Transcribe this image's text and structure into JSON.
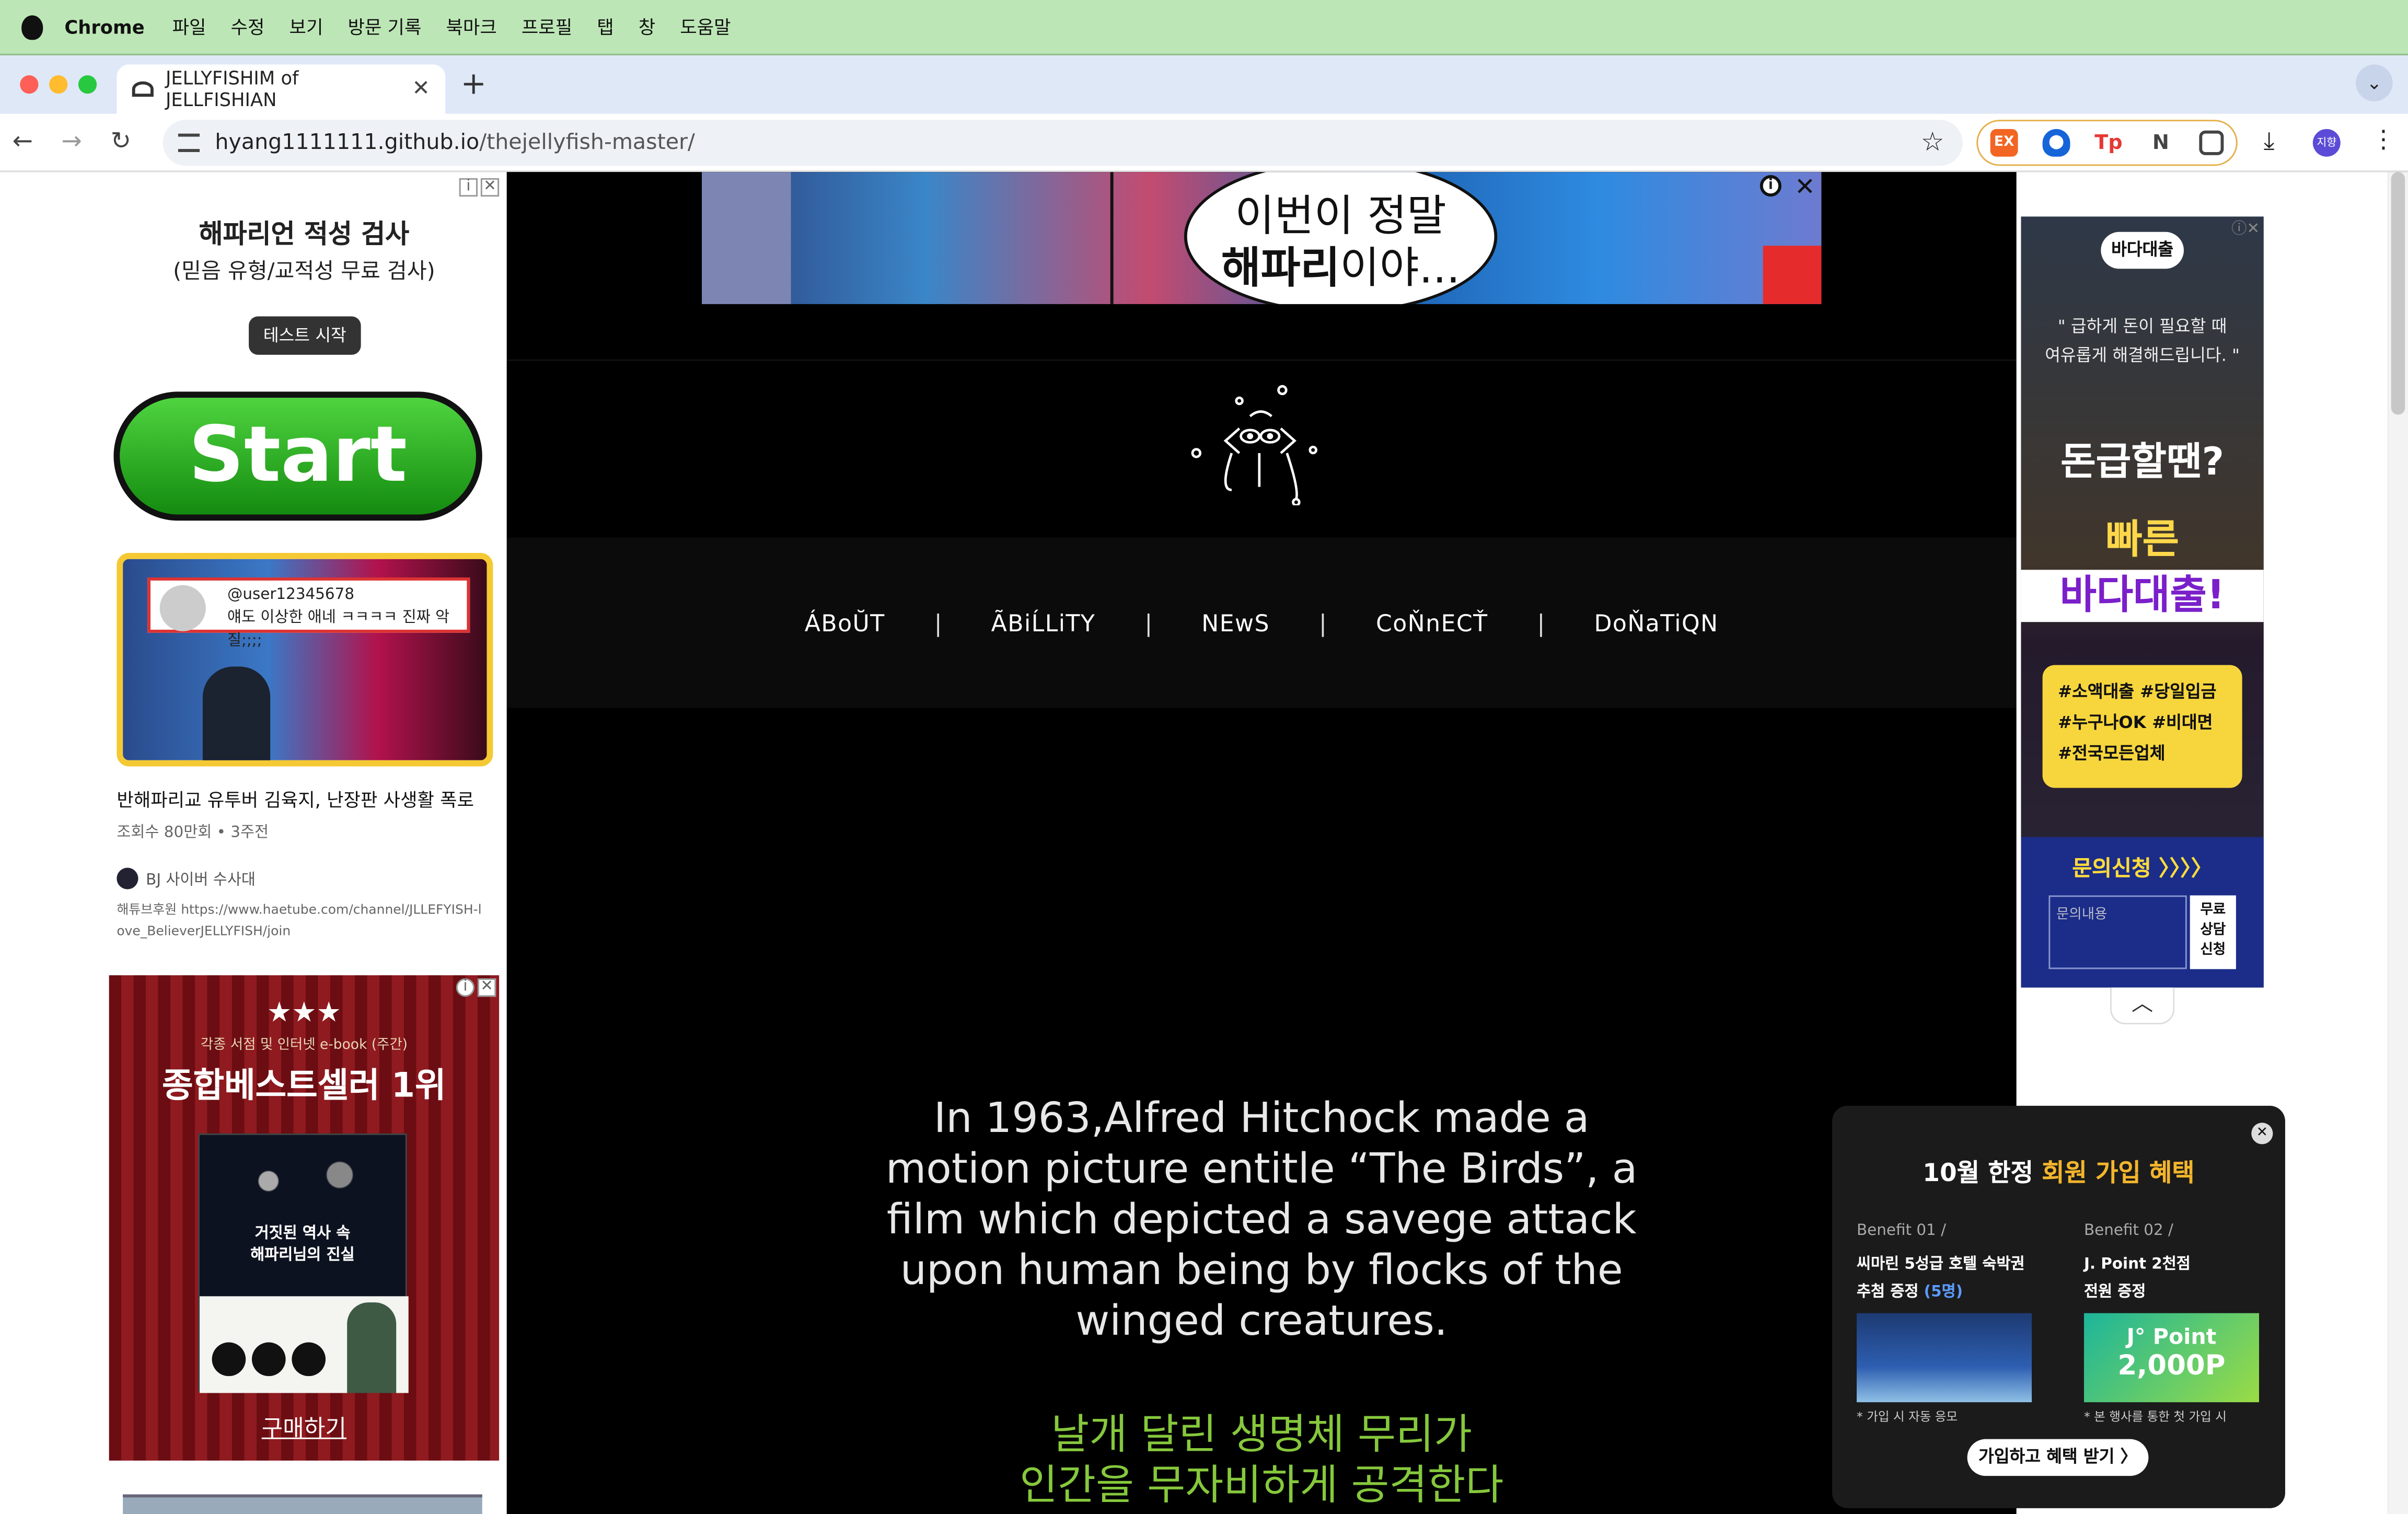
{
  "menubar": {
    "app": "Chrome",
    "items": [
      "파일",
      "수정",
      "보기",
      "방문 기록",
      "북마크",
      "프로필",
      "탭",
      "창",
      "도움말"
    ]
  },
  "tab": {
    "title": "JELLYFISHIM of JELLFISHIAN"
  },
  "address": {
    "url_host": "hyang1111111.github.io",
    "url_path": "/thejellyfish-master/"
  },
  "profile": {
    "initials": "지향"
  },
  "left_ad": {
    "title": "해파리언 적성 검사",
    "subtitle": "(믿음 유형/교적성 무료 검사)",
    "test_button": "테스트 시작",
    "start_button": "Start",
    "comment_user": "@user12345678",
    "comment_text": "얘도 이상한 애네 ㅋㅋㅋㅋ 진짜 악질;;;;",
    "video_title": "반해파리교 유투버 김육지, 난장판 사생활 폭로",
    "video_meta": "조회수 80만회 • 3주전",
    "channel": "BJ 사이버 수사대",
    "description": "해튜브후원 https://www.haetube.com/channel/JLLEFYISH-love_BelieverJELLYFISH/join"
  },
  "book_ad": {
    "stars": "★★★",
    "tiny": "각종 서점 및 인터넷 e-book (주간)",
    "best": "종합베스트셀러 1위",
    "book_title": "거짓된 역사 속\n해파리님의 진실",
    "buy": "구매하기"
  },
  "top_ad": {
    "line1": "이번이 정말",
    "line2_bold": "해파리",
    "line2_rest": "이야..."
  },
  "nav": {
    "items": [
      "ÁBoŬT",
      "ÃBiĹLiTY",
      "NEwS",
      "CoŇnECŤ",
      "DoŇaTiQN"
    ],
    "sep": "|"
  },
  "intro": {
    "text": "In 1963,Alfred Hitchock made a motion picture entitle “The Birds”, a film which depicted a savege attack upon human being by flocks of the winged creatures."
  },
  "korean": {
    "line1": "날개 달린 생명체 무리가",
    "line2": "인간을 무자비하게 공격한다"
  },
  "right_ad": {
    "brand": "바다대출",
    "quote": "\" 급하게 돈이 필요할 때\n여유롭게 해결해드립니다. \"",
    "big1": "돈급할땐?",
    "big2": "빠른",
    "banner": "바다대출!",
    "tags": "#소액대출 #당일입금\n#누구나OK #비대면\n#전국모든업체",
    "cta": "문의신청 〉〉〉〉",
    "input_placeholder": "문의내용",
    "free": "무료\n상담\n신청"
  },
  "popup": {
    "title_a": "10월 한정 ",
    "title_b": "회원 가입 혜택",
    "b1_label": "Benefit 01 /",
    "b1_title": "씨마린 5성급 호텔 숙박권",
    "b1_title2": "추첨 증정",
    "b1_highlight": "(5명)",
    "b1_note": "* 가입 시 자동 응모",
    "b2_label": "Benefit 02 /",
    "b2_title": "J. Point 2천점",
    "b2_title2": "전원 증정",
    "b2_point_name": "J° Point",
    "b2_point_value": "2,000P",
    "b2_note": "* 본 행사를 통한 첫 가입 시",
    "cta": "가입하고 혜택 받기 〉"
  }
}
